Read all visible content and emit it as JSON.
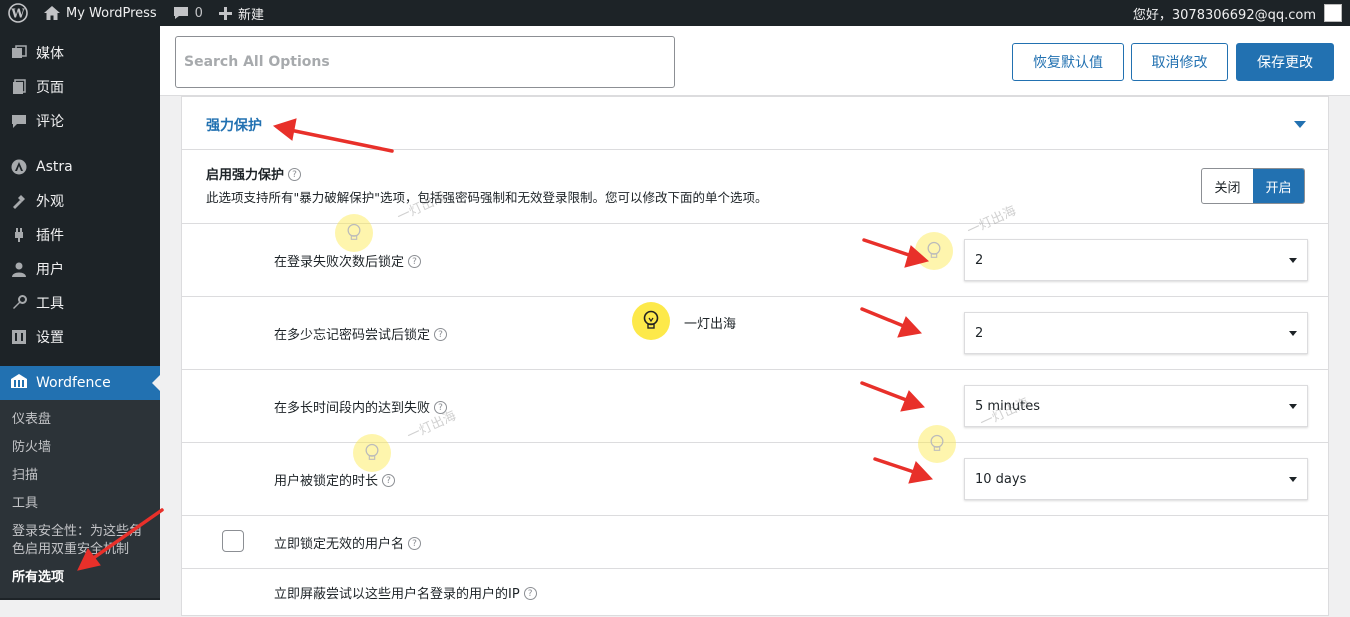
{
  "admin_bar": {
    "site_name": "My WordPress",
    "comments_count": "0",
    "new_label": "新建",
    "greeting": "您好，3078306692@qq.com"
  },
  "sidebar": {
    "items": [
      {
        "label": "媒体",
        "icon": "media-icon"
      },
      {
        "label": "页面",
        "icon": "page-icon"
      },
      {
        "label": "评论",
        "icon": "comment-icon"
      },
      {
        "label": "Astra",
        "icon": "astra-icon"
      },
      {
        "label": "外观",
        "icon": "appearance-icon"
      },
      {
        "label": "插件",
        "icon": "plugin-icon"
      },
      {
        "label": "用户",
        "icon": "user-icon"
      },
      {
        "label": "工具",
        "icon": "wrench-icon"
      },
      {
        "label": "设置",
        "icon": "settings-icon"
      }
    ],
    "active": {
      "label": "Wordfence",
      "icon": "wordfence-icon"
    },
    "submenu": [
      "仪表盘",
      "防火墙",
      "扫描",
      "工具",
      "登录安全性：为这些角色启用双重安全机制",
      "所有选项"
    ]
  },
  "toolbar": {
    "search_placeholder": "Search All Options",
    "restore_label": "恢复默认值",
    "cancel_label": "取消修改",
    "save_label": "保存更改"
  },
  "section": {
    "title": "强力保护",
    "enable": {
      "title": "启用强力保护",
      "desc": "此选项支持所有\"暴力破解保护\"选项，包括强密码强制和无效登录限制。您可以修改下面的单个选项。",
      "off_label": "关闭",
      "on_label": "开启",
      "state": "on"
    },
    "options": [
      {
        "label": "在登录失败次数后锁定",
        "value": "2"
      },
      {
        "label": "在多少忘记密码尝试后锁定",
        "value": "2"
      },
      {
        "label": "在多长时间段内的达到失败",
        "value": "5 minutes"
      },
      {
        "label": "用户被锁定的时长",
        "value": "10 days"
      }
    ],
    "checkbox_label": "立即锁定无效的用户名",
    "ip_label": "立即屏蔽尝试以这些用户名登录的用户的IP"
  },
  "watermark": {
    "text": "一灯出海"
  },
  "colors": {
    "accent": "#2271b1",
    "admin_dark": "#1d2327",
    "arrow_red": "#e8302a",
    "bulb_yellow": "#fde94a"
  }
}
